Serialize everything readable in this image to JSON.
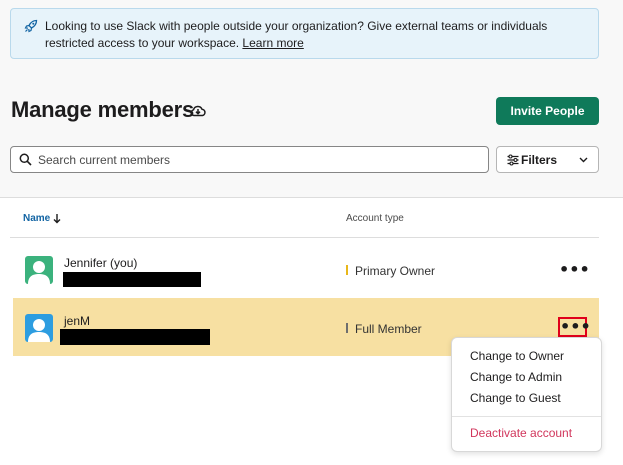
{
  "banner": {
    "text": "Looking to use Slack with people outside your organization? Give external teams or individuals restricted access to your workspace.",
    "link": "Learn more",
    "icon": "rocket-icon"
  },
  "page": {
    "title": "Manage members",
    "invite_button": "Invite People"
  },
  "search": {
    "placeholder": "Search current members"
  },
  "filters": {
    "label": "Filters"
  },
  "table": {
    "headers": {
      "name": "Name",
      "account_type": "Account type"
    },
    "rows": [
      {
        "name": "Jennifer (you)",
        "account_type": "Primary Owner",
        "avatar_color": "#3bb27d",
        "highlighted": false
      },
      {
        "name": "jenM",
        "account_type": "Full Member",
        "avatar_color": "#2d9de0",
        "highlighted": true
      }
    ],
    "more_glyph": "•••"
  },
  "menu": {
    "items": [
      "Change to Owner",
      "Change to Admin",
      "Change to Guest"
    ],
    "danger_item": "Deactivate account"
  },
  "colors": {
    "accent_green": "#0f7a5a",
    "link_blue": "#1264a3",
    "highlight_row": "#f7e0a2",
    "danger": "#d1365c",
    "callout_red": "#e0001b"
  }
}
